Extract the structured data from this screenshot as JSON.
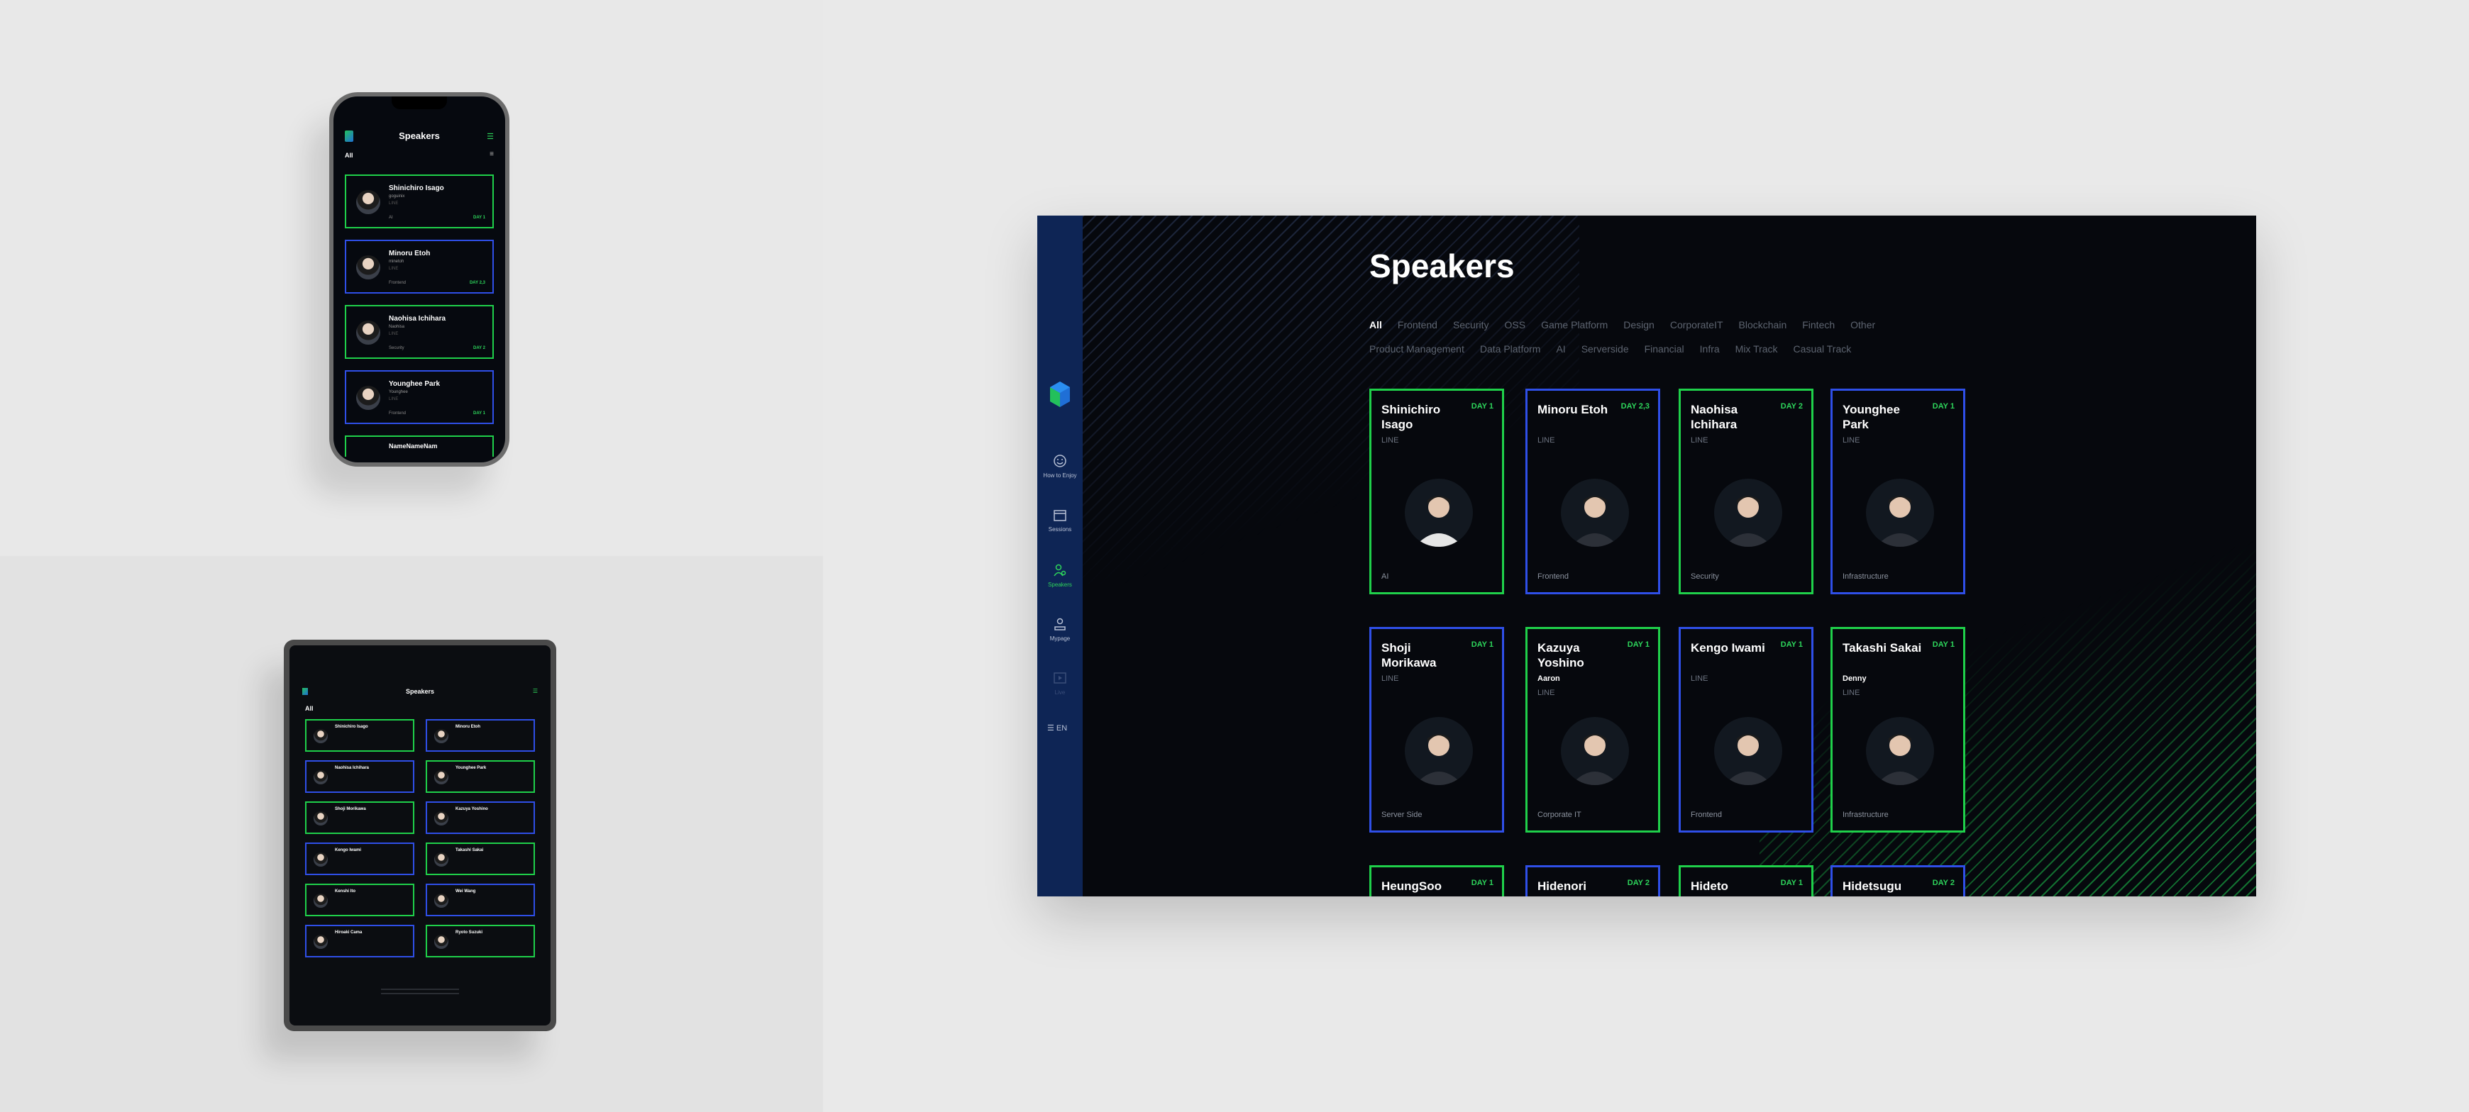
{
  "phone": {
    "title": "Speakers",
    "filter": "All",
    "speakers": [
      {
        "name": "Shinichiro Isago",
        "handle": "goguinix",
        "company": "LINE",
        "track": "AI",
        "day": "DAY 1",
        "color": "green"
      },
      {
        "name": "Minoru Etoh",
        "handle": "minetoh",
        "company": "LINE",
        "track": "Frontend",
        "day": "DAY 2,3",
        "color": "blue"
      },
      {
        "name": "Naohisa Ichihara",
        "handle": "Naohisa",
        "company": "LINE",
        "track": "Security",
        "day": "DAY 2",
        "color": "green"
      },
      {
        "name": "Younghee Park",
        "handle": "Younghee",
        "company": "LINE",
        "track": "Frontend",
        "day": "DAY 1",
        "color": "blue"
      }
    ],
    "partial": "NameNameNam"
  },
  "tablet": {
    "title": "Speakers",
    "filter": "All",
    "speakers": [
      {
        "name": "Shinichiro Isago",
        "color": "green"
      },
      {
        "name": "Minoru Etoh",
        "color": "blue"
      },
      {
        "name": "Naohisa Ichihara",
        "color": "blue"
      },
      {
        "name": "Younghee Park",
        "color": "green"
      },
      {
        "name": "Shoji Morikawa",
        "color": "green"
      },
      {
        "name": "Kazuya Yoshino",
        "color": "blue"
      },
      {
        "name": "Kengo Iwami",
        "color": "blue"
      },
      {
        "name": "Takashi Sakai",
        "color": "green"
      },
      {
        "name": "Kenshi Ito",
        "color": "green"
      },
      {
        "name": "Wei Wang",
        "color": "blue"
      },
      {
        "name": "Hiroaki Cama",
        "color": "blue"
      },
      {
        "name": "Ryoto Suzuki",
        "color": "green"
      }
    ]
  },
  "desktop": {
    "title": "Speakers",
    "language": "EN",
    "sidebar": [
      {
        "label": "How to Enjoy",
        "icon": "smile-icon"
      },
      {
        "label": "Sessions",
        "icon": "calendar-icon"
      },
      {
        "label": "Speakers",
        "icon": "speaker-icon"
      },
      {
        "label": "Mypage",
        "icon": "user-icon"
      },
      {
        "label": "Live",
        "icon": "play-icon"
      }
    ],
    "filters_row1": [
      "All",
      "Frontend",
      "Security",
      "OSS",
      "Game Platform",
      "Design",
      "CorporateIT",
      "Blockchain",
      "Fintech",
      "Other"
    ],
    "filters_row2": [
      "Product Management",
      "Data Platform",
      "AI",
      "Serverside",
      "Financial",
      "Infra",
      "Mix Track",
      "Casual Track"
    ],
    "cards": [
      {
        "name": "Shinichiro Isago",
        "day": "DAY 1",
        "handle": "",
        "company": "LINE",
        "track": "AI",
        "color": "green"
      },
      {
        "name": "Minoru Etoh",
        "day": "DAY 2,3",
        "handle": "",
        "company": "LINE",
        "track": "Frontend",
        "color": "blue"
      },
      {
        "name": "Naohisa Ichihara",
        "day": "DAY 2",
        "handle": "",
        "company": "LINE",
        "track": "Security",
        "color": "green"
      },
      {
        "name": "Younghee Park",
        "day": "DAY 1",
        "handle": "",
        "company": "LINE",
        "track": "Infrastructure",
        "color": "blue"
      },
      {
        "name": "Shoji Morikawa",
        "day": "DAY 1",
        "handle": "",
        "company": "LINE",
        "track": "Server Side",
        "color": "blue"
      },
      {
        "name": "Kazuya Yoshino",
        "day": "DAY 1",
        "handle": "Aaron",
        "company": "LINE",
        "track": "Corporate IT",
        "color": "green"
      },
      {
        "name": "Kengo Iwami",
        "day": "DAY 1",
        "handle": "",
        "company": "LINE",
        "track": "Frontend",
        "color": "blue"
      },
      {
        "name": "Takashi Sakai",
        "day": "DAY 1",
        "handle": "Denny",
        "company": "LINE",
        "track": "Infrastructure",
        "color": "green"
      },
      {
        "name": "HeungSoo",
        "day": "DAY 1",
        "handle": "",
        "company": "",
        "track": "",
        "color": "green"
      },
      {
        "name": "Hidenori",
        "day": "DAY 2",
        "handle": "",
        "company": "",
        "track": "",
        "color": "blue"
      },
      {
        "name": "Hideto",
        "day": "DAY 1",
        "handle": "",
        "company": "",
        "track": "",
        "color": "green"
      },
      {
        "name": "Hidetsugu",
        "day": "DAY 2",
        "handle": "",
        "company": "",
        "track": "",
        "color": "blue"
      }
    ]
  }
}
